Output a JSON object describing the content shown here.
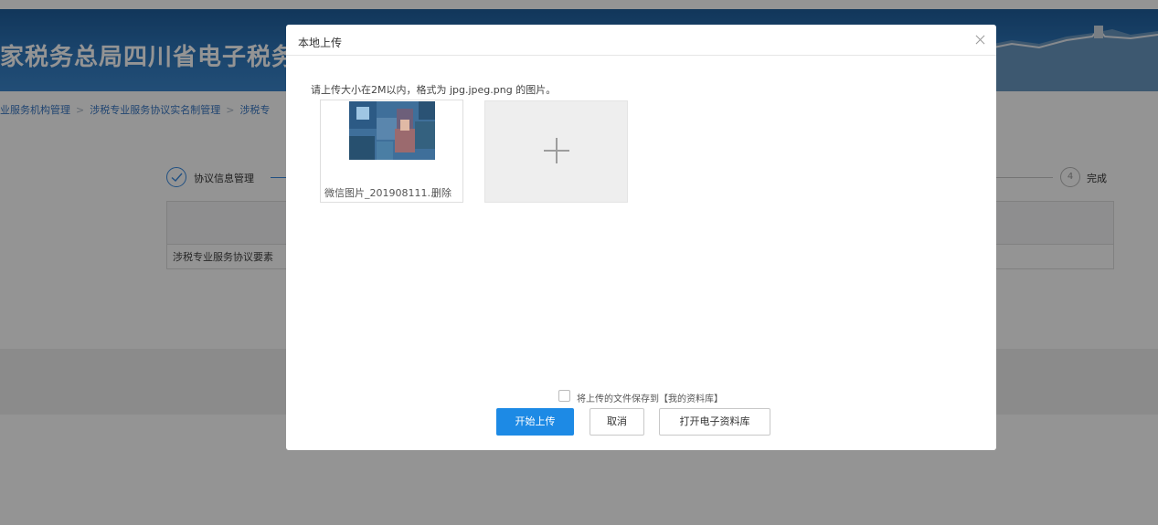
{
  "page": {
    "banner_title": "家税务总局四川省电子税务局",
    "breadcrumbs": [
      "业服务机构管理",
      "涉税专业服务协议实名制管理",
      "涉税专"
    ],
    "steps": {
      "step1_label": "协议信息管理",
      "step4_number": "4",
      "step4_label": "完成"
    },
    "table_row_text": "涉税专业服务协议要素"
  },
  "modal": {
    "title": "本地上传",
    "close_icon": "close-icon",
    "hint": "请上传大小在2M以内，格式为 jpg.jpeg.png 的图片。",
    "uploaded_file": {
      "name": "微信图片_201908111...",
      "delete_label": "删除"
    },
    "add_icon": "plus-icon",
    "save_checkbox_label": "将上传的文件保存到【我的资料库】",
    "buttons": {
      "start_upload": "开始上传",
      "cancel": "取消",
      "open_library": "打开电子资料库"
    }
  },
  "colors": {
    "primary": "#1d8ae5",
    "banner": "#2f78bd",
    "link": "#3a78c3"
  }
}
